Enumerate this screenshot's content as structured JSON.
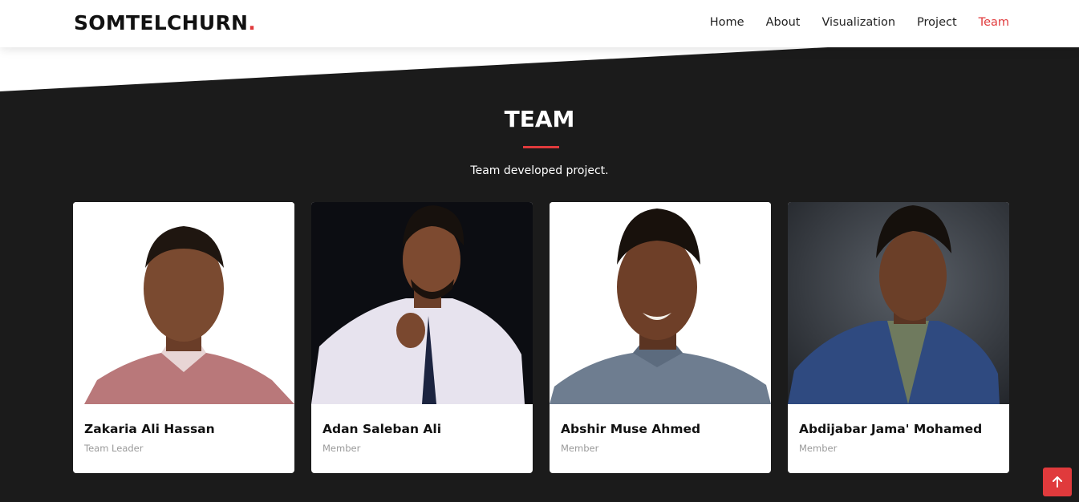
{
  "header": {
    "logo_text": "SOMTELCHURN",
    "logo_dot": ".",
    "nav": [
      {
        "label": "Home"
      },
      {
        "label": "About"
      },
      {
        "label": "Visualization"
      },
      {
        "label": "Project"
      },
      {
        "label": "Team"
      }
    ],
    "active_nav": "Team"
  },
  "section": {
    "title": "TEAM",
    "subtitle": "Team developed project."
  },
  "team": [
    {
      "name": "Zakaria Ali Hassan",
      "role": "Team Leader"
    },
    {
      "name": "Adan Saleban Ali",
      "role": "Member"
    },
    {
      "name": "Abshir Muse Ahmed",
      "role": "Member"
    },
    {
      "name": "Abdijabar Jama' Mohamed",
      "role": "Member"
    }
  ],
  "back_to_top_icon": "arrow-up-icon",
  "colors": {
    "accent": "#e03a3c",
    "section_bg": "#1b1b1b",
    "header_bg": "#ffffff"
  }
}
